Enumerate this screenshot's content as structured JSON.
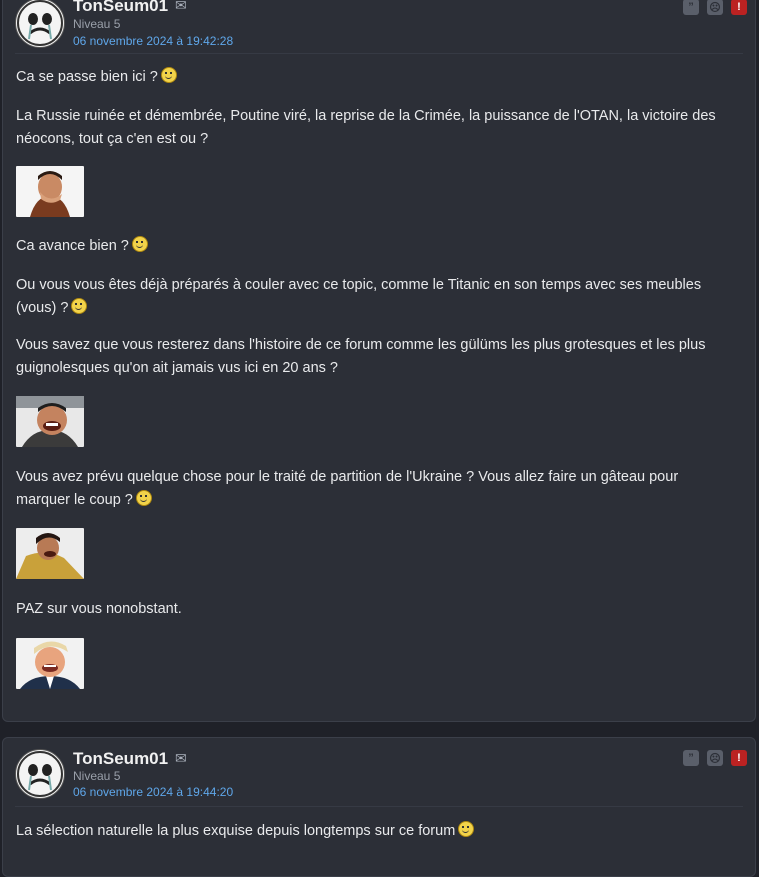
{
  "post1": {
    "username": "TonSeum01",
    "level": "Niveau 5",
    "date": "06 novembre 2024 à 19:42:28",
    "paragraphs": [
      "Ca se passe bien ici ?",
      "La Russie ruinée et démembrée, Poutine viré, la reprise de la Crimée, la puissance de l'OTAN, la victoire des néocons, tout ça c'en est ou ?",
      "Ca avance bien ?",
      "Ou vous vous êtes déjà préparés à couler avec ce topic, comme le Titanic en son temps avec ses meubles (vous) ?",
      "Vous savez que vous resterez dans l'histoire de ce forum comme les gülüms les plus grotesques et les plus guignolesques qu'on ait jamais vus ici en 20 ans ?",
      "Vous avez prévu quelque chose pour le traité de partition de l'Ukraine ? Vous allez faire un gâteau pour marquer le coup ?",
      "PAZ sur vous nonobstant."
    ],
    "stickers": [
      "sticker-facepalm",
      "sticker-risitas-laugh",
      "sticker-risitas-bent",
      "sticker-trump-laugh"
    ]
  },
  "post2": {
    "username": "TonSeum01",
    "level": "Niveau 5",
    "date": "06 novembre 2024 à 19:44:20",
    "paragraphs": [
      "La sélection naturelle la plus exquise depuis longtemps sur ce forum"
    ]
  },
  "actions": {
    "quote_icon": "quote-icon",
    "sad_icon": "sad-face-icon",
    "alert_icon": "alert-icon",
    "mail_icon": "mail-icon"
  },
  "colors": {
    "background": "#1f2128",
    "card": "#2c2f37",
    "date_link": "#5fa7ea",
    "alert": "#bb2222"
  }
}
